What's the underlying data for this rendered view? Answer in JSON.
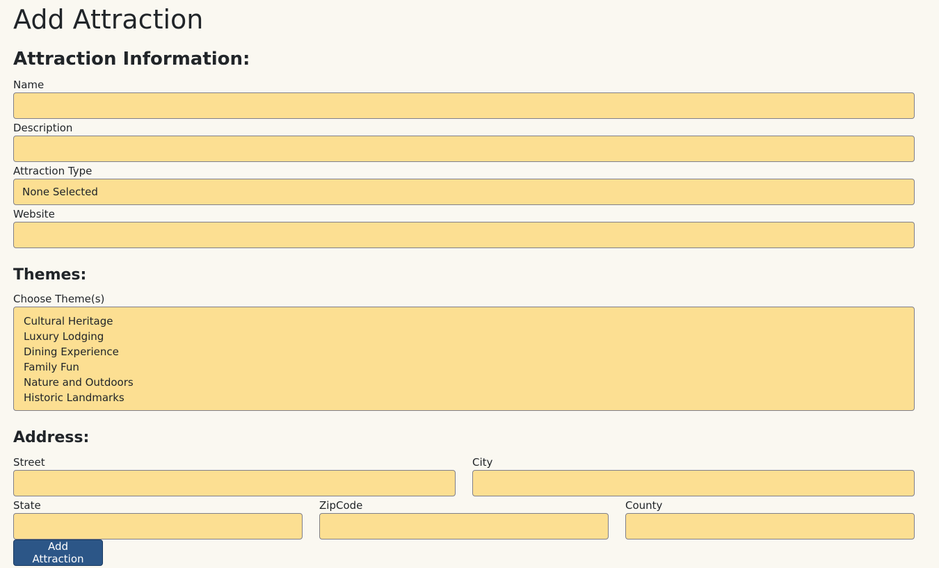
{
  "page": {
    "title": "Add Attraction"
  },
  "attraction_info": {
    "heading": "Attraction Information:",
    "name_label": "Name",
    "name_value": "",
    "description_label": "Description",
    "description_value": "",
    "type_label": "Attraction Type",
    "type_selected": "None Selected",
    "website_label": "Website",
    "website_value": ""
  },
  "themes": {
    "heading": "Themes:",
    "label": "Choose Theme(s)",
    "options": [
      "Cultural Heritage",
      "Luxury Lodging",
      "Dining Experience",
      "Family Fun",
      "Nature and Outdoors",
      "Historic Landmarks"
    ]
  },
  "address": {
    "heading": "Address:",
    "street_label": "Street",
    "street_value": "",
    "city_label": "City",
    "city_value": "",
    "state_label": "State",
    "state_value": "",
    "zip_label": "ZipCode",
    "zip_value": "",
    "county_label": "County",
    "county_value": ""
  },
  "actions": {
    "submit_label": "Add Attraction"
  },
  "colors": {
    "background": "#faf8f1",
    "field_fill": "#fcdf92",
    "field_border": "#7f7f8a",
    "button_fill": "#2c5687",
    "text": "#212529"
  }
}
